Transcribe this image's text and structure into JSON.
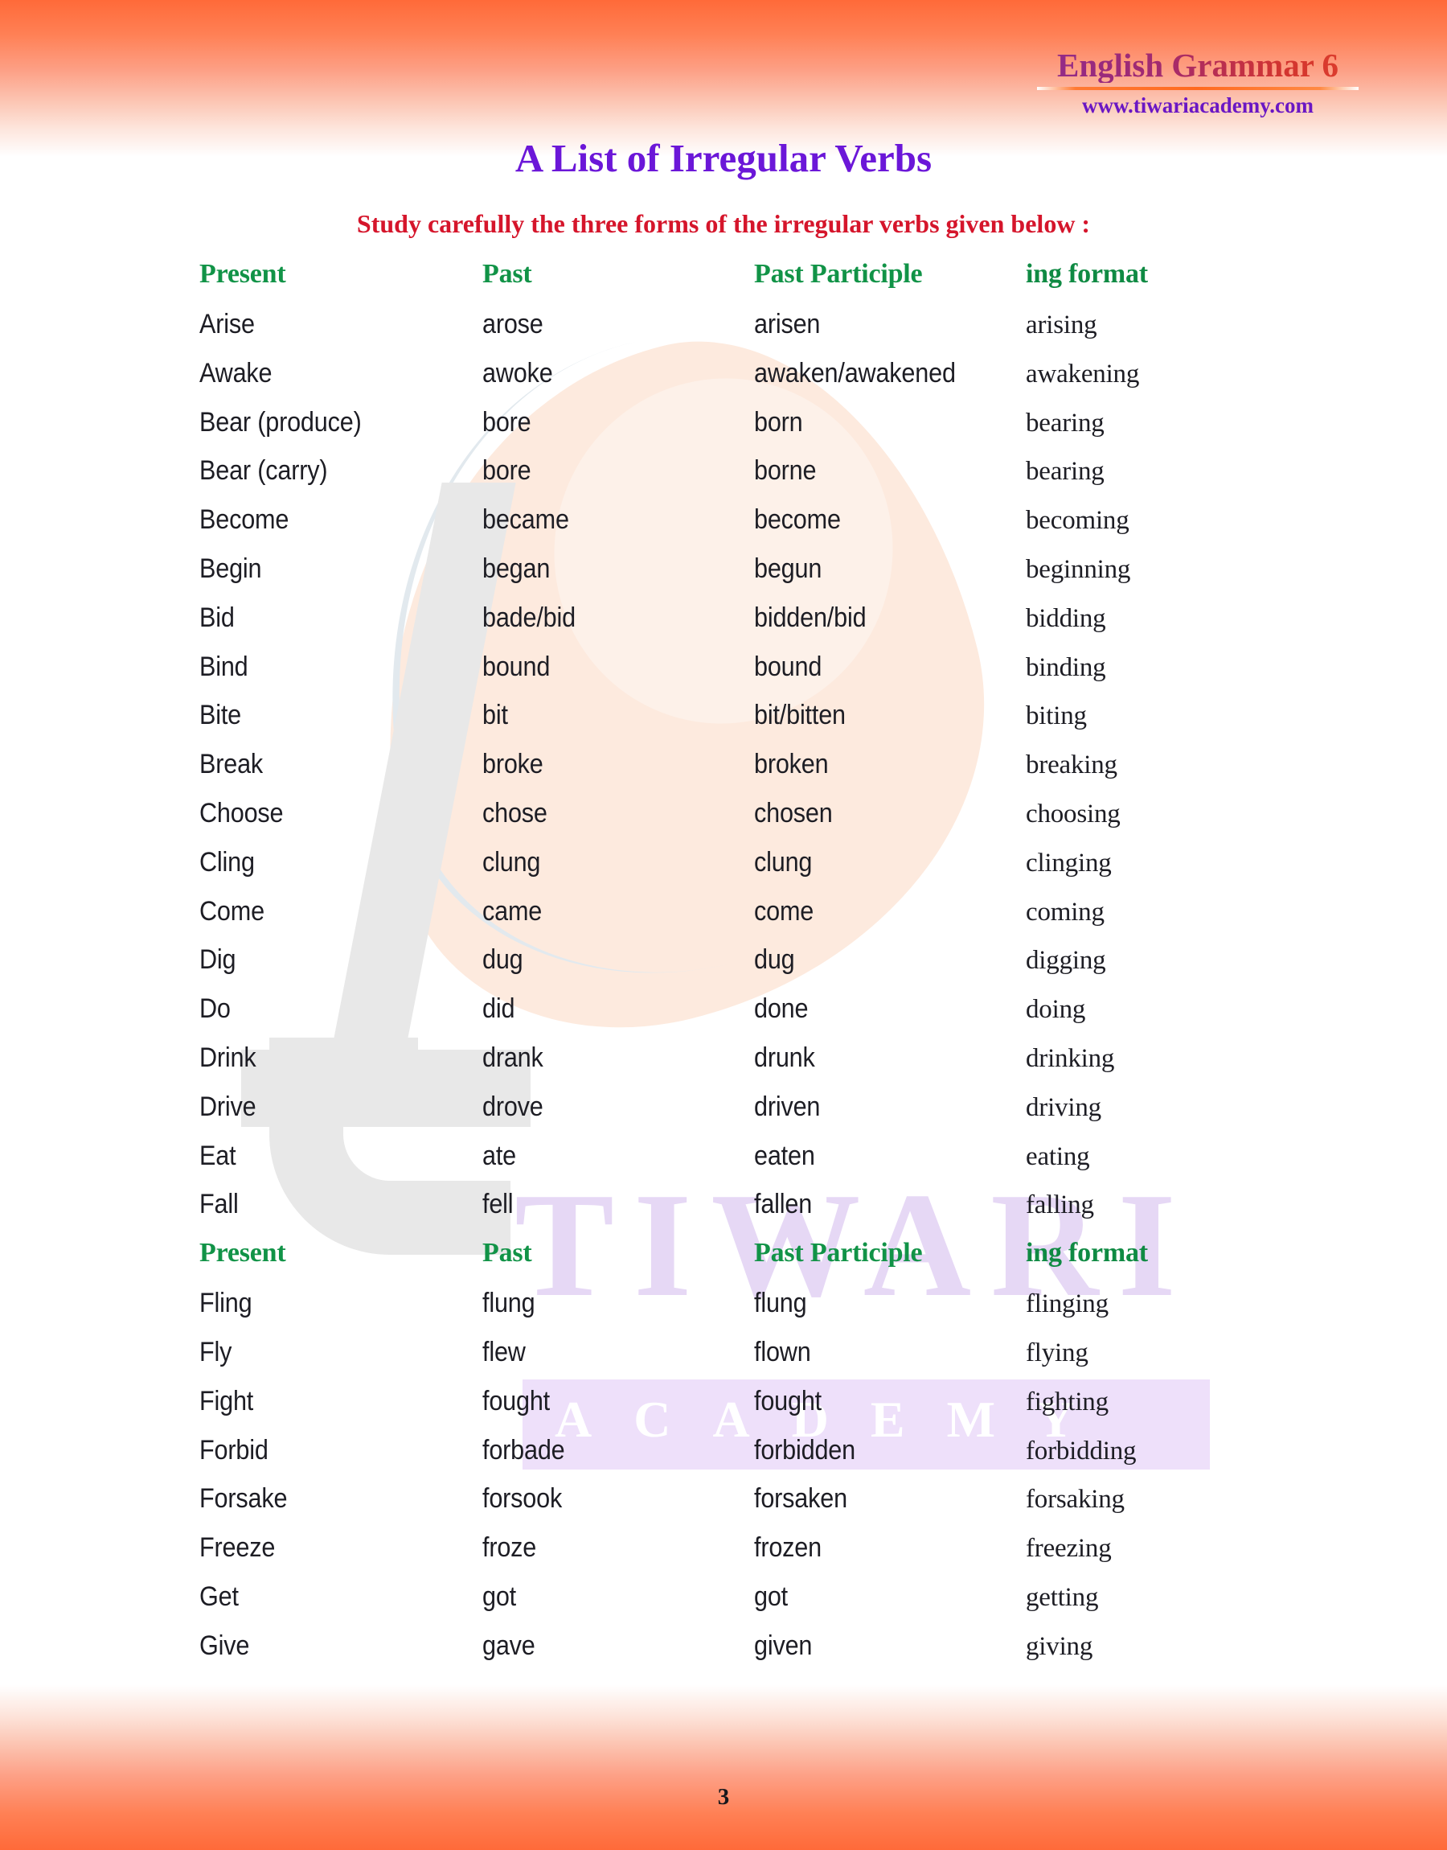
{
  "brand": {
    "title": "English Grammar 6",
    "url": "www.tiwariacademy.com",
    "title_gradient_from": "#8e2b8e",
    "title_gradient_to": "#e0402c",
    "url_color": "#6a17c4"
  },
  "document": {
    "title": "A List of Irregular Verbs",
    "title_color": "#6b17d8",
    "subtitle": "Study carefully the three forms of the irregular verbs given below :",
    "subtitle_color": "#d5152b",
    "page_number": "3"
  },
  "watermark": {
    "wordmark": "TIWARI",
    "sub_wordmark": "ACADEMY",
    "logo_letter": "t",
    "wordmark_color": "#e6d8f5",
    "band_color": "#eee0fa",
    "logo_color": "#e8e8e8",
    "leaf_color": "#fdeade"
  },
  "decoration": {
    "band_color_top": "#ff6a39",
    "band_color_bottom": "#ff6a39"
  },
  "table": {
    "headers": [
      "Present",
      "Past",
      "Past Participle",
      "ing format"
    ],
    "header_color": "#119347",
    "rows": [
      {
        "type": "header",
        "cells": [
          "Present",
          "Past",
          "Past Participle",
          "ing format"
        ]
      },
      {
        "type": "data",
        "cells": [
          "Arise",
          "arose",
          "arisen",
          "arising"
        ]
      },
      {
        "type": "data",
        "cells": [
          "Awake",
          "awoke",
          "awaken/awakened",
          "awakening"
        ]
      },
      {
        "type": "data",
        "cells": [
          "Bear (produce)",
          "bore",
          "born",
          "bearing"
        ]
      },
      {
        "type": "data",
        "cells": [
          "Bear (carry)",
          "bore",
          "borne",
          "bearing"
        ]
      },
      {
        "type": "data",
        "cells": [
          "Become",
          "became",
          "become",
          "becoming"
        ]
      },
      {
        "type": "data",
        "cells": [
          "Begin",
          "began",
          "begun",
          "beginning"
        ]
      },
      {
        "type": "data",
        "cells": [
          "Bid",
          "bade/bid",
          "bidden/bid",
          "bidding"
        ]
      },
      {
        "type": "data",
        "cells": [
          "Bind",
          "bound",
          "bound",
          "binding"
        ]
      },
      {
        "type": "data",
        "cells": [
          "Bite",
          "bit",
          "bit/bitten",
          "biting"
        ]
      },
      {
        "type": "data",
        "cells": [
          "Break",
          "broke",
          "broken",
          "breaking"
        ]
      },
      {
        "type": "data",
        "cells": [
          "Choose",
          "chose",
          "chosen",
          "choosing"
        ]
      },
      {
        "type": "data",
        "cells": [
          "Cling",
          "clung",
          "clung",
          "clinging"
        ]
      },
      {
        "type": "data",
        "cells": [
          "Come",
          "came",
          "come",
          "coming"
        ]
      },
      {
        "type": "data",
        "cells": [
          "Dig",
          "dug",
          "dug",
          "digging"
        ]
      },
      {
        "type": "data",
        "cells": [
          "Do",
          "did",
          "done",
          "doing"
        ]
      },
      {
        "type": "data",
        "cells": [
          "Drink",
          "drank",
          "drunk",
          "drinking"
        ]
      },
      {
        "type": "data",
        "cells": [
          "Drive",
          "drove",
          "driven",
          "driving"
        ]
      },
      {
        "type": "data",
        "cells": [
          "Eat",
          "ate",
          "eaten",
          "eating"
        ]
      },
      {
        "type": "data",
        "cells": [
          "Fall",
          "fell",
          "fallen",
          "falling"
        ]
      },
      {
        "type": "header",
        "cells": [
          "Present",
          "Past",
          "Past Participle",
          "ing format"
        ]
      },
      {
        "type": "data",
        "cells": [
          "Fling",
          "flung",
          "flung",
          "flinging"
        ]
      },
      {
        "type": "data",
        "cells": [
          "Fly",
          "flew",
          "flown",
          "flying"
        ]
      },
      {
        "type": "data",
        "cells": [
          "Fight",
          "fought",
          "fought",
          "fighting"
        ]
      },
      {
        "type": "data",
        "cells": [
          "Forbid",
          "forbade",
          "forbidden",
          "forbidding"
        ]
      },
      {
        "type": "data",
        "cells": [
          "Forsake",
          "forsook",
          "forsaken",
          "forsaking"
        ]
      },
      {
        "type": "data",
        "cells": [
          "Freeze",
          "froze",
          "frozen",
          "freezing"
        ]
      },
      {
        "type": "data",
        "cells": [
          "Get",
          "got",
          "got",
          "getting"
        ]
      },
      {
        "type": "data",
        "cells": [
          "Give",
          "gave",
          "given",
          "giving"
        ]
      }
    ]
  }
}
